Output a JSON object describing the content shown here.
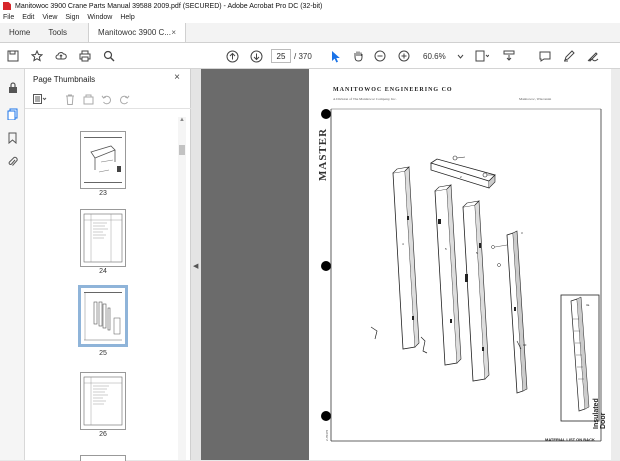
{
  "window": {
    "title": "Manitowoc 3900 Crane Parts Manual 39588 2009.pdf (SECURED) - Adobe Acrobat Pro DC (32-bit)"
  },
  "menu": [
    "File",
    "Edit",
    "View",
    "Sign",
    "Window",
    "Help"
  ],
  "tabs": {
    "home": "Home",
    "tools": "Tools",
    "document": "Manitowoc 3900 C...",
    "close": "×"
  },
  "toolbar": {
    "current_page": "25",
    "page_count": "/ 370",
    "zoom": "60.6%"
  },
  "panel": {
    "title": "Page Thumbnails",
    "close": "×",
    "thumbnails": [
      {
        "label": "23"
      },
      {
        "label": "24"
      },
      {
        "label": "25",
        "selected": true
      },
      {
        "label": "26"
      }
    ]
  },
  "document": {
    "heading": "MANITOWOC ENGINEERING CO",
    "subheading": "A Division of The Manitowoc Company, Inc.",
    "location": "Manitowoc, Wisconsin",
    "master_stamp": "MASTER",
    "side_title": "Insulated Door",
    "note": "MATERIAL LIST ON BACK",
    "code": "Z-70476"
  },
  "colors": {
    "accent": "#1a73e8",
    "acrobat_red": "#d7262b",
    "viewer_bg": "#6b6b6b",
    "selection": "#8fb4d9"
  }
}
